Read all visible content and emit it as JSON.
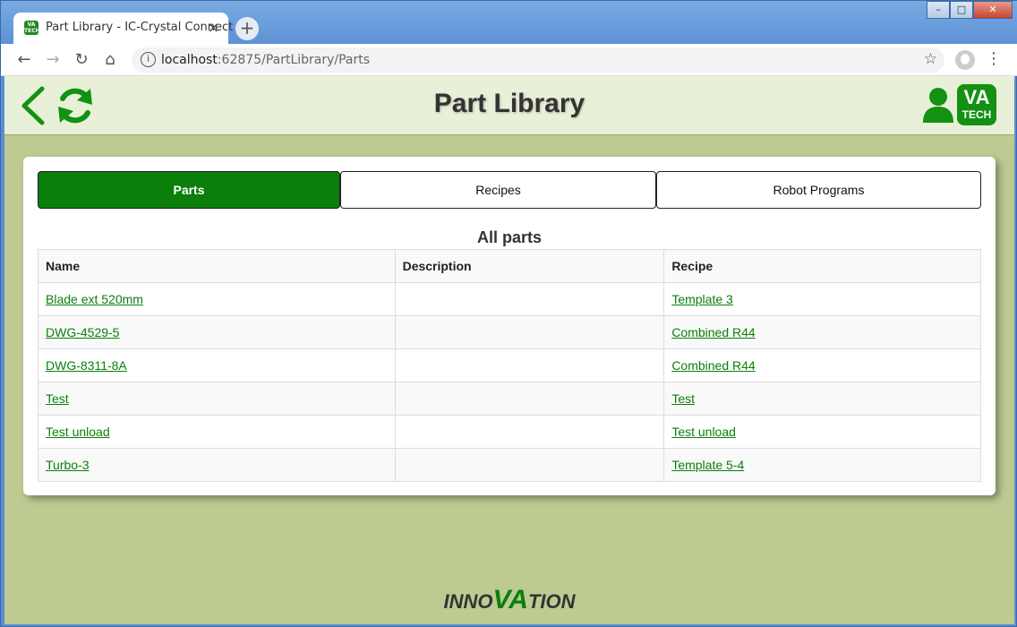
{
  "browser": {
    "tab_title": "Part Library - IC-Crystal Connect",
    "tab_favicon_text": "VA TECH",
    "tab_close": "×",
    "new_tab": "+",
    "url_host": "localhost",
    "url_path": ":62875/PartLibrary/Parts",
    "window_controls": {
      "minimize": "–",
      "maximize": "□",
      "close": "✕"
    }
  },
  "header": {
    "title": "Part Library",
    "logo_top": "VA",
    "logo_bottom": "TECH"
  },
  "tabs": [
    {
      "label": "Parts",
      "active": true
    },
    {
      "label": "Recipes",
      "active": false
    },
    {
      "label": "Robot Programs",
      "active": false
    }
  ],
  "table": {
    "title": "All parts",
    "columns": [
      "Name",
      "Description",
      "Recipe"
    ],
    "rows": [
      {
        "name": "Blade ext 520mm",
        "description": "",
        "recipe": "Template 3"
      },
      {
        "name": "DWG-4529-5",
        "description": "",
        "recipe": "Combined R44"
      },
      {
        "name": "DWG-8311-8A",
        "description": "",
        "recipe": "Combined R44"
      },
      {
        "name": "Test",
        "description": "",
        "recipe": "Test"
      },
      {
        "name": "Test unload",
        "description": "",
        "recipe": "Test unload"
      },
      {
        "name": "Turbo-3",
        "description": "",
        "recipe": "Template 5-4"
      }
    ]
  },
  "footer": {
    "brand_pre": "INNO",
    "brand_va": "VA",
    "brand_post": "TION"
  },
  "colors": {
    "accent": "#0a7f0a",
    "background": "#bdca92",
    "header_bg": "#e8f0d8"
  },
  "icons": {
    "back": "back-chevron-icon",
    "refresh": "refresh-icon",
    "user": "user-icon",
    "info": "info-icon",
    "star": "star-icon",
    "menu": "menu-dots-icon"
  }
}
